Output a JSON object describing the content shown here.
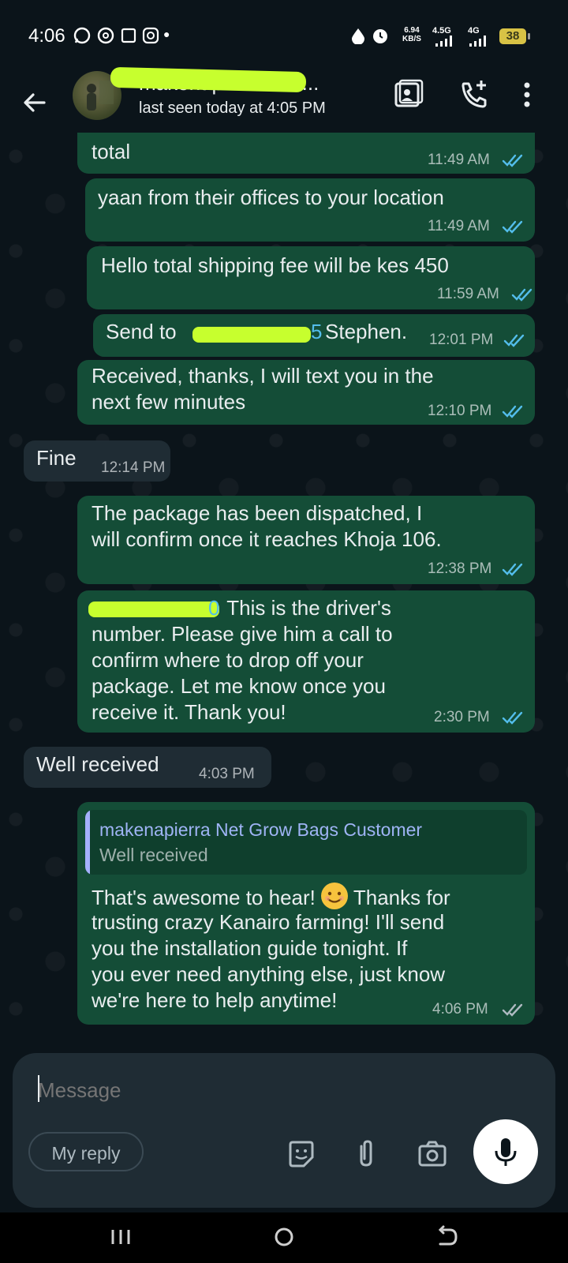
{
  "status_bar": {
    "time": "4:06",
    "net_speed_value": "6.94",
    "net_speed_unit": "KB/S",
    "sim1_label": "4.5G",
    "sim2_label": "4G",
    "battery": "38"
  },
  "header": {
    "contact_name": "makenapierra Net...",
    "last_seen": "last seen today at 4:05 PM"
  },
  "messages": [
    {
      "text": "total",
      "time": "11:49 AM"
    },
    {
      "text": "yaan from their offices to your location",
      "time": "11:49 AM"
    },
    {
      "text": "Hello total shipping fee will be kes 450",
      "time": "11:59 AM"
    },
    {
      "prefix": "Send to",
      "number_tail": "5",
      "suffix": "Stephen.",
      "time": "12:01 PM"
    },
    {
      "text": "Received, thanks, I will text you in the\nnext few minutes",
      "time": "12:10 PM"
    },
    {
      "text": "Fine",
      "time": "12:14 PM"
    },
    {
      "text": "The package has been dispatched, I\nwill confirm once it reaches Khoja 106.",
      "time": "12:38 PM"
    },
    {
      "number_tail": "0",
      "text": " This is the driver's",
      "text2": "number. Please give him a call to\nconfirm where to drop off your\npackage. Let me know once you\nreceive it. Thank you!",
      "time": "2:30 PM"
    },
    {
      "text": "Well received",
      "time": "4:03 PM"
    },
    {
      "quote_name": "makenapierra Net Grow Bags Customer",
      "quote_text": "Well received",
      "text_a": "That's awesome to hear! ",
      "text_b": " Thanks for",
      "text_c": "trusting crazy Kanairo farming! I'll send\nyou the installation guide tonight. If\nyou ever need anything else, just know\nwe're here to help anytime!",
      "time": "4:06 PM"
    }
  ],
  "composer": {
    "placeholder": "Message",
    "my_reply": "My reply"
  },
  "colors": {
    "outgoing": "#144d37",
    "incoming": "#1f2c34",
    "read_ticks": "#53bdeb",
    "highlighter": "#c7ff2e"
  }
}
